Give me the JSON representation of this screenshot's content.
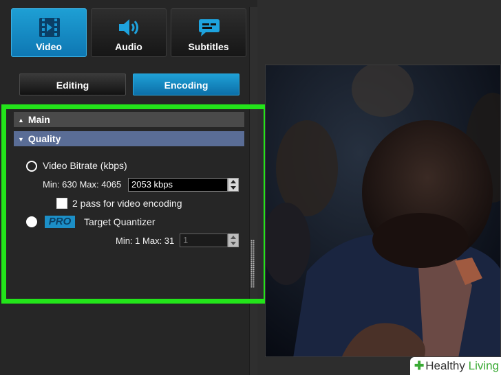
{
  "tabs": [
    {
      "label": "Video",
      "icon": "film-icon",
      "active": true
    },
    {
      "label": "Audio",
      "icon": "speaker-icon",
      "active": false
    },
    {
      "label": "Subtitles",
      "icon": "speech-bubble-icon",
      "active": false
    }
  ],
  "subtabs": [
    {
      "label": "Editing",
      "active": false
    },
    {
      "label": "Encoding",
      "active": true
    }
  ],
  "sections": {
    "main": "Main",
    "quality": "Quality"
  },
  "quality": {
    "bitrate_option": "Video Bitrate (kbps)",
    "bitrate_range": "Min: 630 Max: 4065",
    "bitrate_value": "2053 kbps",
    "two_pass_label": "2 pass for video encoding",
    "pro_badge": "PRO",
    "quantizer_option": "Target Quantizer",
    "quantizer_range": "Min: 1 Max: 31",
    "quantizer_value": "1"
  },
  "watermark": {
    "brand_part1": "Healthy",
    "brand_part2": "Living"
  },
  "colors": {
    "accent": "#1a96d0",
    "highlight_frame": "#23e41a",
    "quality_header": "#5a6d96"
  }
}
